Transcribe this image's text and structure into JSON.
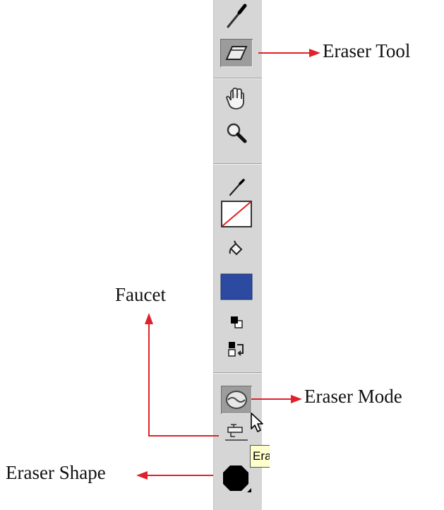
{
  "callouts": {
    "eraser_tool": "Eraser Tool",
    "faucet": "Faucet",
    "eraser_mode": "Eraser Mode",
    "eraser_shape": "Eraser Shape"
  },
  "tooltip": {
    "text": "Era"
  },
  "toolbar": {
    "tools": [
      {
        "name": "eyedropper-icon"
      },
      {
        "name": "eraser-icon",
        "selected": true
      },
      {
        "name": "hand-icon"
      },
      {
        "name": "zoom-icon"
      },
      {
        "name": "stroke-color-pencil-icon"
      },
      {
        "name": "no-color-swatch"
      },
      {
        "name": "paint-bucket-icon"
      },
      {
        "name": "fill-color-swatch"
      },
      {
        "name": "black-white-icon"
      },
      {
        "name": "swap-colors-icon"
      },
      {
        "name": "eraser-mode-icon"
      },
      {
        "name": "faucet-icon"
      },
      {
        "name": "eraser-shape-icon"
      }
    ],
    "fill_color": "#2b4aa0",
    "no_color_line": "#e02020",
    "arrow_color": "#e0202a"
  }
}
